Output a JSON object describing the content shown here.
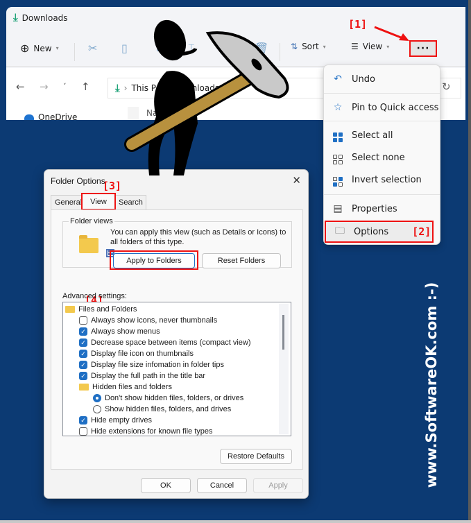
{
  "explorer": {
    "title": "Downloads",
    "toolbar": {
      "new_label": "New",
      "sort_label": "Sort",
      "view_label": "View",
      "more_label": "···"
    },
    "breadcrumb": [
      "This PC",
      "Downloads"
    ],
    "sidebar_item": "OneDrive",
    "column_header": "Name"
  },
  "annotations": {
    "step1": "[1]",
    "step2": "[2]",
    "step3": "[3]",
    "step4": "[4]"
  },
  "context_menu": {
    "items": [
      {
        "label": "Undo",
        "icon": "undo-icon"
      },
      {
        "label": "Pin to Quick access",
        "icon": "star-icon"
      },
      {
        "label": "Select all",
        "icon": "select-all-icon"
      },
      {
        "label": "Select none",
        "icon": "select-none-icon"
      },
      {
        "label": "Invert selection",
        "icon": "invert-selection-icon"
      },
      {
        "label": "Properties",
        "icon": "properties-icon"
      },
      {
        "label": "Options",
        "icon": "folder-options-icon"
      }
    ]
  },
  "dialog": {
    "title": "Folder Options",
    "close": "✕",
    "tabs": [
      "General",
      "View",
      "Search"
    ],
    "active_tab": "View",
    "folder_views": {
      "label": "Folder views",
      "text": "You can apply this view (such as Details or Icons) to all folders of this type.",
      "apply_button": "Apply to Folders",
      "reset_button": "Reset Folders"
    },
    "advanced_label": "Advanced settings:",
    "tree": [
      {
        "type": "folder",
        "label": "Files and Folders",
        "indent": 0
      },
      {
        "type": "checkbox",
        "label": "Always show icons, never thumbnails",
        "checked": false,
        "indent": 1
      },
      {
        "type": "checkbox",
        "label": "Always show menus",
        "checked": true,
        "indent": 1
      },
      {
        "type": "checkbox",
        "label": "Decrease space between items (compact view)",
        "checked": true,
        "indent": 1
      },
      {
        "type": "checkbox",
        "label": "Display file icon on thumbnails",
        "checked": true,
        "indent": 1
      },
      {
        "type": "checkbox",
        "label": "Display file size infomation in folder tips",
        "checked": true,
        "indent": 1
      },
      {
        "type": "checkbox",
        "label": "Display the full path in the title bar",
        "checked": true,
        "indent": 1
      },
      {
        "type": "folder",
        "label": "Hidden files and folders",
        "indent": 1
      },
      {
        "type": "radio",
        "label": "Don't show hidden files, folders, or drives",
        "checked": true,
        "indent": 2
      },
      {
        "type": "radio",
        "label": "Show hidden files, folders, and drives",
        "checked": false,
        "indent": 2
      },
      {
        "type": "checkbox",
        "label": "Hide empty drives",
        "checked": true,
        "indent": 1
      },
      {
        "type": "checkbox",
        "label": "Hide extensions for known file types",
        "checked": false,
        "indent": 1
      }
    ],
    "restore_defaults": "Restore Defaults",
    "ok": "OK",
    "cancel": "Cancel",
    "apply": "Apply"
  },
  "watermark": "www.SoftwareOK.com :-)"
}
